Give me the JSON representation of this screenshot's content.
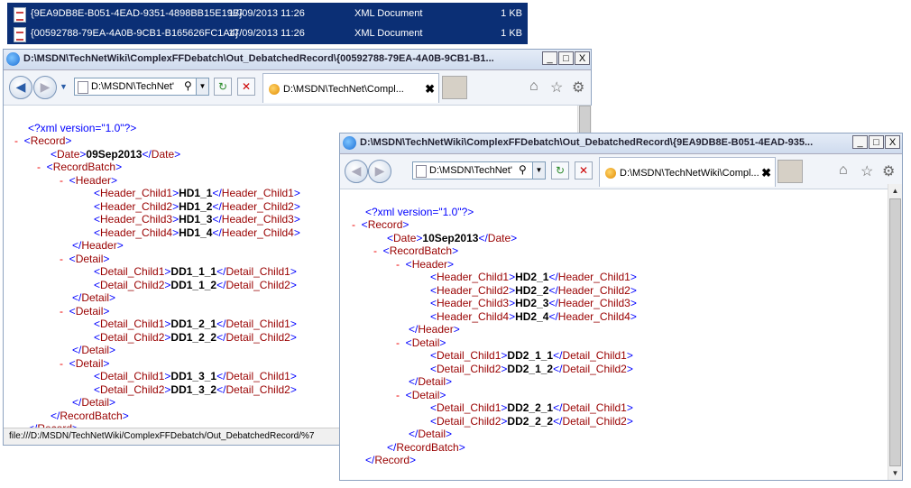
{
  "explorer": {
    "files": [
      {
        "name": "{9EA9DB8E-B051-4EAD-9351-4898BB15E19B}",
        "date": "17/09/2013 11:26",
        "type": "XML Document",
        "size": "1 KB"
      },
      {
        "name": "{00592788-79EA-4A0B-9CB1-B165626FC1A4}",
        "date": "17/09/2013 11:26",
        "type": "XML Document",
        "size": "1 KB"
      }
    ]
  },
  "windowA": {
    "title": "D:\\MSDN\\TechNetWiki\\ComplexFFDebatch\\Out_DebatchedRecord\\{00592788-79EA-4A0B-9CB1-B1...",
    "address": "D:\\MSDN\\TechNet'",
    "tab_title": "D:\\MSDN\\TechNet\\Compl...",
    "status": "file:///D:/MSDN/TechNetWiki/ComplexFFDebatch/Out_DebatchedRecord/%7"
  },
  "windowB": {
    "title": "D:\\MSDN\\TechNetWiki\\ComplexFFDebatch\\Out_DebatchedRecord\\{9EA9DB8E-B051-4EAD-935...",
    "address": "D:\\MSDN\\TechNet'",
    "tab_title": "D:\\MSDN\\TechNetWiki\\Compl..."
  },
  "controls": {
    "minimize": "_",
    "maximize": "□",
    "close": "X",
    "back": "◀",
    "forward": "▶",
    "refresh": "↻",
    "stop": "✕",
    "tab_close": "✖"
  },
  "xml": {
    "pi": "<?xml version=\"1.0\"?>",
    "minus": "-",
    "lt": "<",
    "gt": ">",
    "lt_slash": "</",
    "record_tag": "Record",
    "date_tag": "Date",
    "batch_tag": "RecordBatch",
    "header_tag": "Header",
    "detail_tag": "Detail",
    "h1": "Header_Child1",
    "h2": "Header_Child2",
    "h3": "Header_Child3",
    "h4": "Header_Child4",
    "d1": "Detail_Child1",
    "d2": "Detail_Child2"
  },
  "docA": {
    "date": "09Sep2013",
    "header": [
      "HD1_1",
      "HD1_2",
      "HD1_3",
      "HD1_4"
    ],
    "details": [
      [
        "DD1_1_1",
        "DD1_1_2"
      ],
      [
        "DD1_2_1",
        "DD1_2_2"
      ],
      [
        "DD1_3_1",
        "DD1_3_2"
      ]
    ]
  },
  "docB": {
    "date": "10Sep2013",
    "header": [
      "HD2_1",
      "HD2_2",
      "HD2_3",
      "HD2_4"
    ],
    "details": [
      [
        "DD2_1_1",
        "DD2_1_2"
      ],
      [
        "DD2_2_1",
        "DD2_2_2"
      ]
    ]
  }
}
